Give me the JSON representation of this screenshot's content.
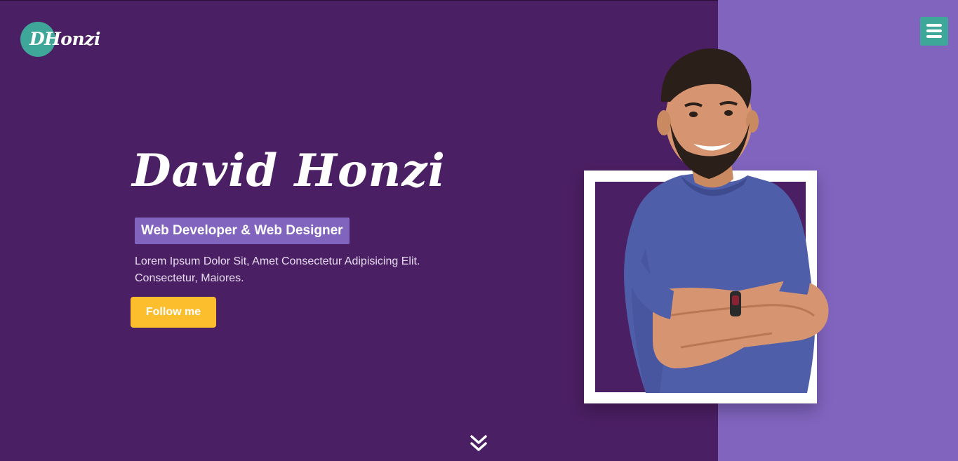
{
  "brand": {
    "logo_text": "DHonzi",
    "accent_color": "#3fa79a"
  },
  "nav": {
    "menu_icon": "hamburger-icon"
  },
  "hero": {
    "name": "David Honzi",
    "role": "Web Developer & Web Designer",
    "description": "Lorem Ipsum Dolor Sit, Amet Consectetur Adipisicing Elit. Consectetur, Maiores.",
    "cta_label": "Follow me",
    "scroll_icon": "double-chevron-down-icon"
  },
  "colors": {
    "background": "#4b1f63",
    "panel": "#8064be",
    "cta": "#fdbe2e",
    "badge": "#8064be"
  }
}
